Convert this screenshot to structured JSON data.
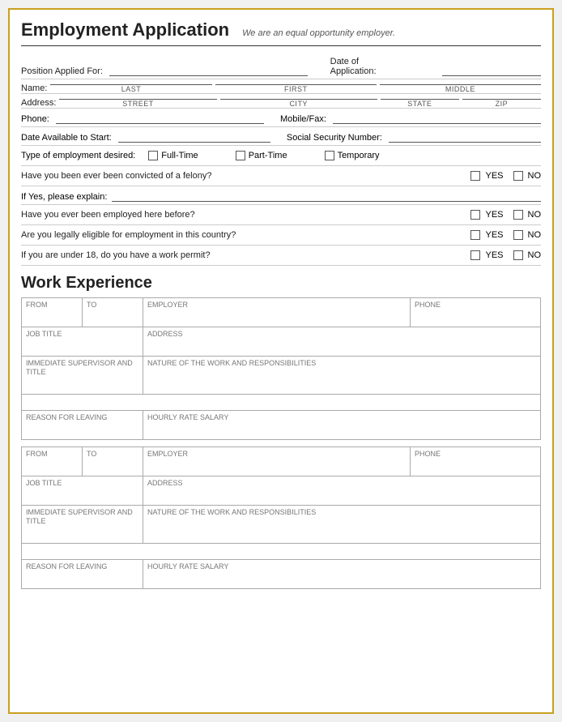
{
  "header": {
    "title": "Employment Application",
    "subtitle": "We are an equal opportunity employer."
  },
  "fields": {
    "position_label": "Position Applied For:",
    "date_label": "Date of",
    "application_label": "Application:",
    "name_label": "Name:",
    "name_last": "LAST",
    "name_first": "FIRST",
    "name_middle": "MIDDLE",
    "address_label": "Address:",
    "addr_street": "STREET",
    "addr_city": "CITY",
    "addr_state": "STATE",
    "addr_zip": "ZIP",
    "phone_label": "Phone:",
    "mobile_label": "Mobile/Fax:",
    "date_avail_label": "Date Available to Start:",
    "ssn_label": "Social Security Number:",
    "emp_type_label": "Type of employment desired:",
    "fulltime": "Full-Time",
    "parttime": "Part-Time",
    "temporary": "Temporary",
    "felony_q": "Have you been ever been convicted of a felony?",
    "yes": "YES",
    "no": "NO",
    "explain_label": "If Yes, please explain:",
    "employed_here_q": "Have you ever been employed here before?",
    "eligible_q": "Are you legally eligible for employment in this country?",
    "work_permit_q": "If you are under 18, do you have a work permit?"
  },
  "work_experience": {
    "title": "Work Experience",
    "table1": {
      "from": "FROM",
      "to": "TO",
      "employer": "EMPLOYER",
      "phone": "PHONE",
      "job_title": "JOB TITLE",
      "address": "ADDRESS",
      "supervisor": "Immediate supervisor and title",
      "nature": "Nature of the work and responsibilities",
      "reason": "Reason for Leaving",
      "hourly": "Hourly Rate Salary"
    },
    "table2": {
      "from": "FROM",
      "to": "TO",
      "employer": "EMPLOYER",
      "phone": "PHONE",
      "job_title": "JOB TITLE",
      "address": "ADDRESS",
      "supervisor": "Immediate supervisor and title",
      "nature": "Nature of the work and responsibilities",
      "reason": "Reason for Leaving",
      "hourly": "Hourly Rate Salary"
    }
  }
}
